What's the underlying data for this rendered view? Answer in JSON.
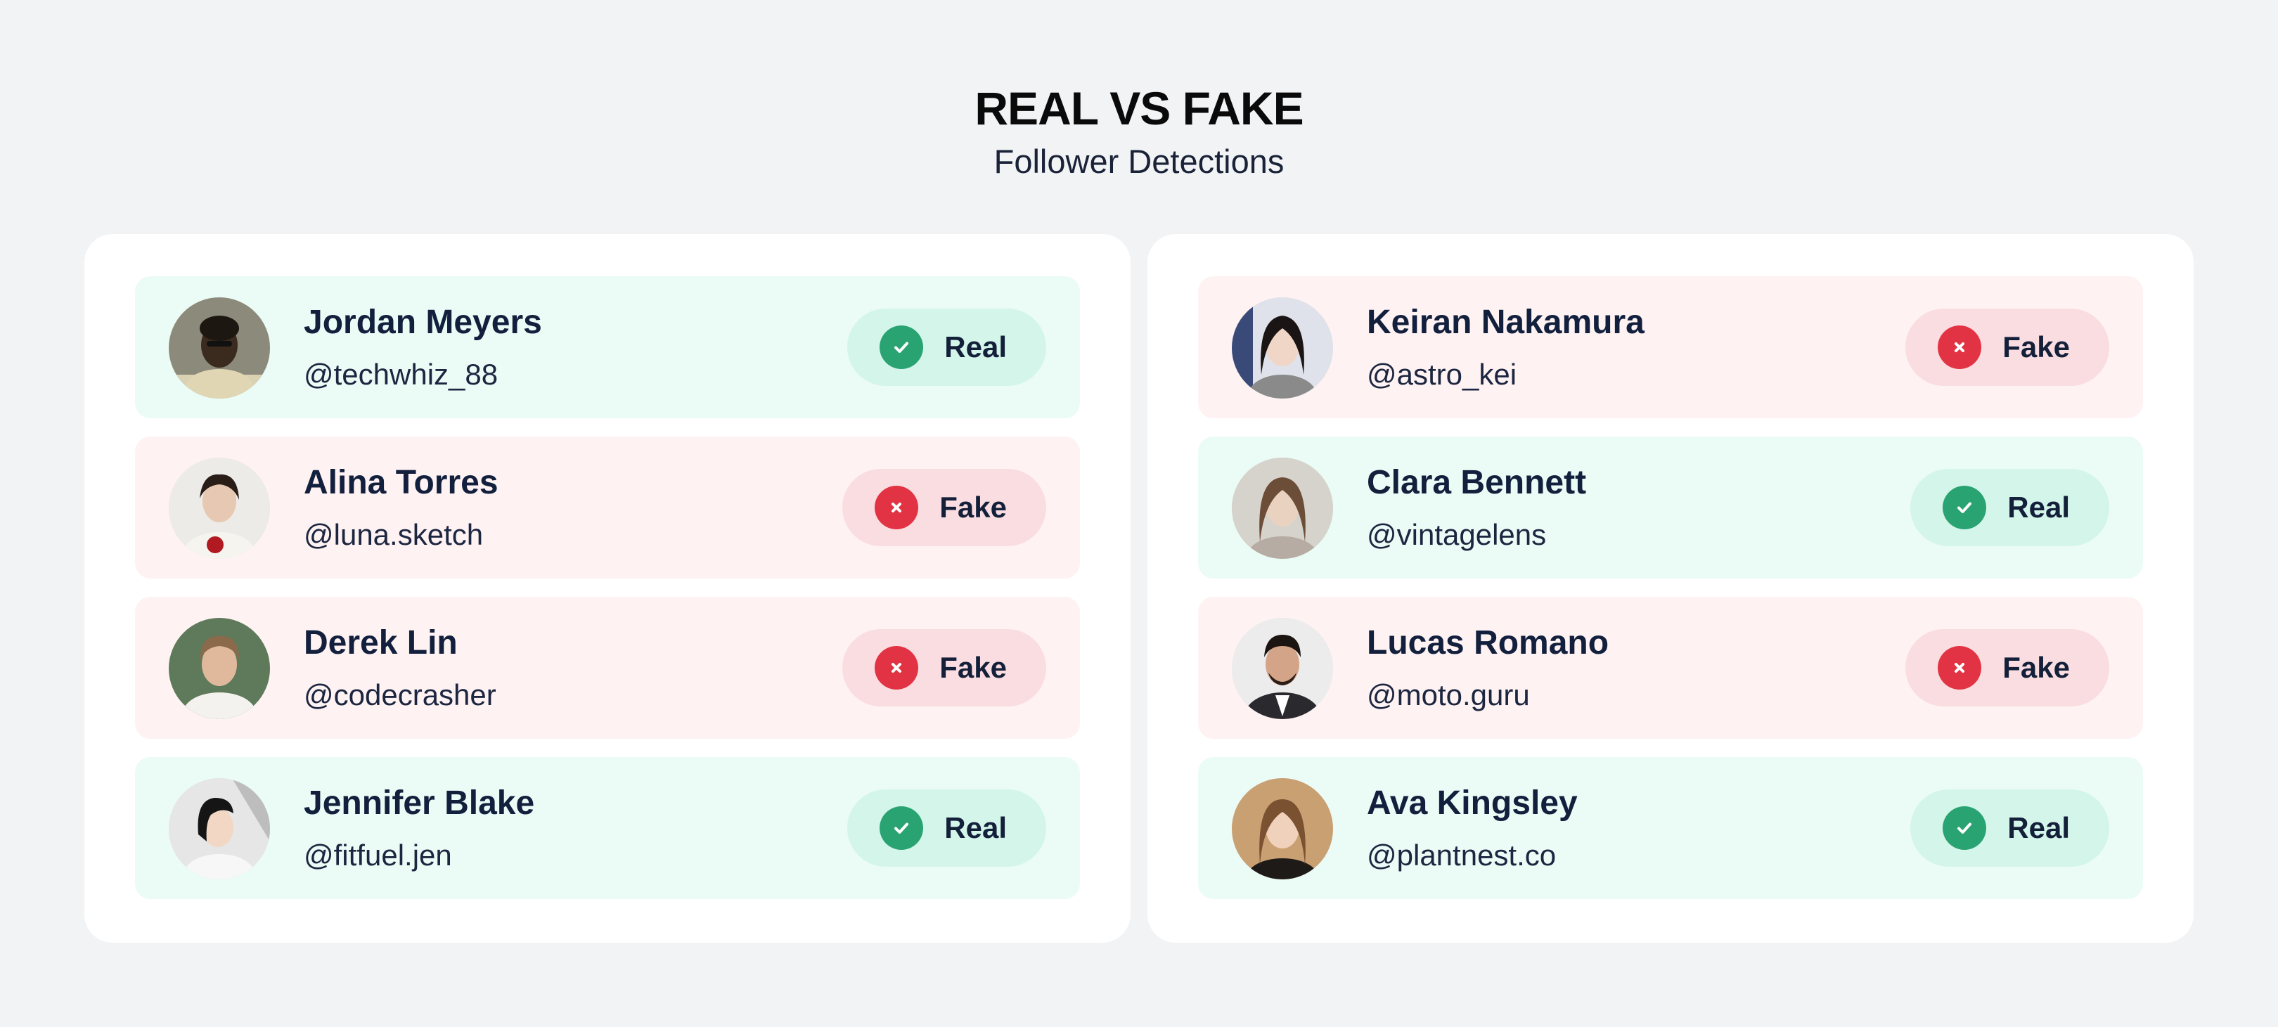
{
  "header": {
    "title": "REAL VS FAKE",
    "subtitle": "Follower Detections"
  },
  "colors": {
    "real_row_bg": "#ebfbf6",
    "fake_row_bg": "#fef2f2",
    "real_badge_bg": "#d3f5ea",
    "fake_badge_bg": "#fadde0",
    "real_icon": "#2aa373",
    "fake_icon": "#e23344"
  },
  "left_panel": {
    "followers": [
      {
        "name": "Jordan Meyers",
        "handle": "@techwhiz_88",
        "status": "Real",
        "icon": "check-icon"
      },
      {
        "name": "Alina Torres",
        "handle": "@luna.sketch",
        "status": "Fake",
        "icon": "x-icon"
      },
      {
        "name": "Derek Lin",
        "handle": "@codecrasher",
        "status": "Fake",
        "icon": "x-icon"
      },
      {
        "name": "Jennifer Blake",
        "handle": "@fitfuel.jen",
        "status": "Real",
        "icon": "check-icon"
      }
    ]
  },
  "right_panel": {
    "followers": [
      {
        "name": "Keiran Nakamura",
        "handle": "@astro_kei",
        "status": "Fake",
        "icon": "x-icon"
      },
      {
        "name": "Clara Bennett",
        "handle": "@vintagelens",
        "status": "Real",
        "icon": "check-icon"
      },
      {
        "name": "Lucas Romano",
        "handle": "@moto.guru",
        "status": "Fake",
        "icon": "x-icon"
      },
      {
        "name": "Ava Kingsley",
        "handle": "@plantnest.co",
        "status": "Real",
        "icon": "check-icon"
      }
    ]
  }
}
